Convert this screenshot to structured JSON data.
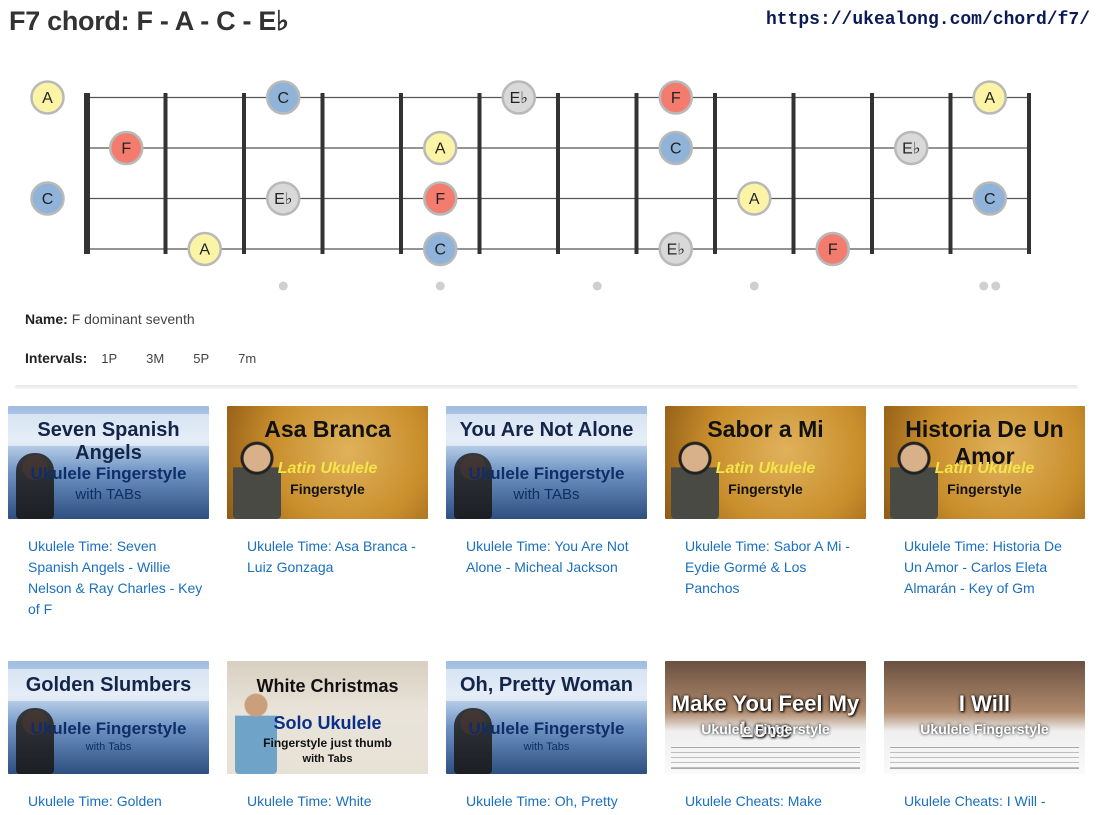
{
  "page": {
    "title": "F7 chord: F - A - C - E♭",
    "url": "https://ukealong.com/chord/f7/"
  },
  "chord": {
    "name_label": "Name:",
    "name_value": "F dominant seventh",
    "intervals_label": "Intervals:",
    "intervals": [
      "1P",
      "3M",
      "5P",
      "7m"
    ]
  },
  "fretboard": {
    "strings": 4,
    "frets": 12,
    "inlay_frets": [
      3,
      5,
      7,
      9,
      12
    ],
    "colors": {
      "F": "#f47c6f",
      "A": "#fbf4a6",
      "C": "#8fb3d9",
      "E♭": "#d9d9d9"
    },
    "notes": [
      {
        "string": 1,
        "fret": 0,
        "note": "A"
      },
      {
        "string": 1,
        "fret": 3,
        "note": "C"
      },
      {
        "string": 1,
        "fret": 6,
        "note": "E♭"
      },
      {
        "string": 1,
        "fret": 8,
        "note": "F"
      },
      {
        "string": 1,
        "fret": 12,
        "note": "A"
      },
      {
        "string": 2,
        "fret": 1,
        "note": "F"
      },
      {
        "string": 2,
        "fret": 5,
        "note": "A"
      },
      {
        "string": 2,
        "fret": 8,
        "note": "C"
      },
      {
        "string": 2,
        "fret": 11,
        "note": "E♭"
      },
      {
        "string": 3,
        "fret": 0,
        "note": "C"
      },
      {
        "string": 3,
        "fret": 3,
        "note": "E♭"
      },
      {
        "string": 3,
        "fret": 5,
        "note": "F"
      },
      {
        "string": 3,
        "fret": 9,
        "note": "A"
      },
      {
        "string": 3,
        "fret": 12,
        "note": "C"
      },
      {
        "string": 4,
        "fret": 2,
        "note": "A"
      },
      {
        "string": 4,
        "fret": 5,
        "note": "C"
      },
      {
        "string": 4,
        "fret": 8,
        "note": "E♭"
      },
      {
        "string": 4,
        "fret": 10,
        "note": "F"
      }
    ]
  },
  "videos": [
    {
      "thumb_title": "Seven Spanish Angels",
      "thumb_sub1": "Ukulele Fingerstyle",
      "thumb_sub2": "with TABs",
      "theme": "sea",
      "link": "Ukulele Time: Seven Spanish Angels - Willie Nelson & Ray Charles - Key of F"
    },
    {
      "thumb_title": "Asa Branca",
      "thumb_sub1": "Latin Ukulele",
      "thumb_sub2": "Fingerstyle",
      "theme": "latin",
      "link": "Ukulele Time: Asa Branca - Luiz Gonzaga"
    },
    {
      "thumb_title": "You Are Not Alone",
      "thumb_sub1": "Ukulele Fingerstyle",
      "thumb_sub2": "with TABs",
      "theme": "sea",
      "link": "Ukulele Time: You Are Not Alone - Micheal Jackson"
    },
    {
      "thumb_title": "Sabor a Mi",
      "thumb_sub1": "Latin Ukulele",
      "thumb_sub2": "Fingerstyle",
      "theme": "latin",
      "link": "Ukulele Time: Sabor A Mi - Eydie Gormé & Los Panchos"
    },
    {
      "thumb_title": "Historia De Un Amor",
      "thumb_sub1": "Latin Ukulele",
      "thumb_sub2": "Fingerstyle",
      "theme": "latin",
      "link": "Ukulele Time: Historia De Un Amor - Carlos Eleta Almarán - Key of Gm"
    },
    {
      "thumb_title": "Golden Slumbers",
      "thumb_sub1": "Ukulele Fingerstyle",
      "thumb_sub2": "with Tabs",
      "theme": "sea",
      "link": "Ukulele Time: Golden"
    },
    {
      "thumb_title": "White Christmas",
      "thumb_sub1": "Solo Ukulele",
      "thumb_sub2": "Fingerstyle just thumb",
      "thumb_sub3": "with Tabs",
      "theme": "xmas",
      "link": "Ukulele Time: White"
    },
    {
      "thumb_title": "Oh, Pretty Woman",
      "thumb_sub1": "Ukulele Fingerstyle",
      "thumb_sub2": "with Tabs",
      "theme": "sea",
      "link": "Ukulele Time: Oh, Pretty"
    },
    {
      "thumb_title": "Make You Feel My Love",
      "thumb_sub1": "Ukulele Fingerstyle",
      "theme": "tab",
      "link": "Ukulele Cheats: Make"
    },
    {
      "thumb_title": "I Will",
      "thumb_sub1": "Ukulele Fingerstyle",
      "theme": "tab",
      "link": "Ukulele Cheats: I Will -"
    }
  ]
}
